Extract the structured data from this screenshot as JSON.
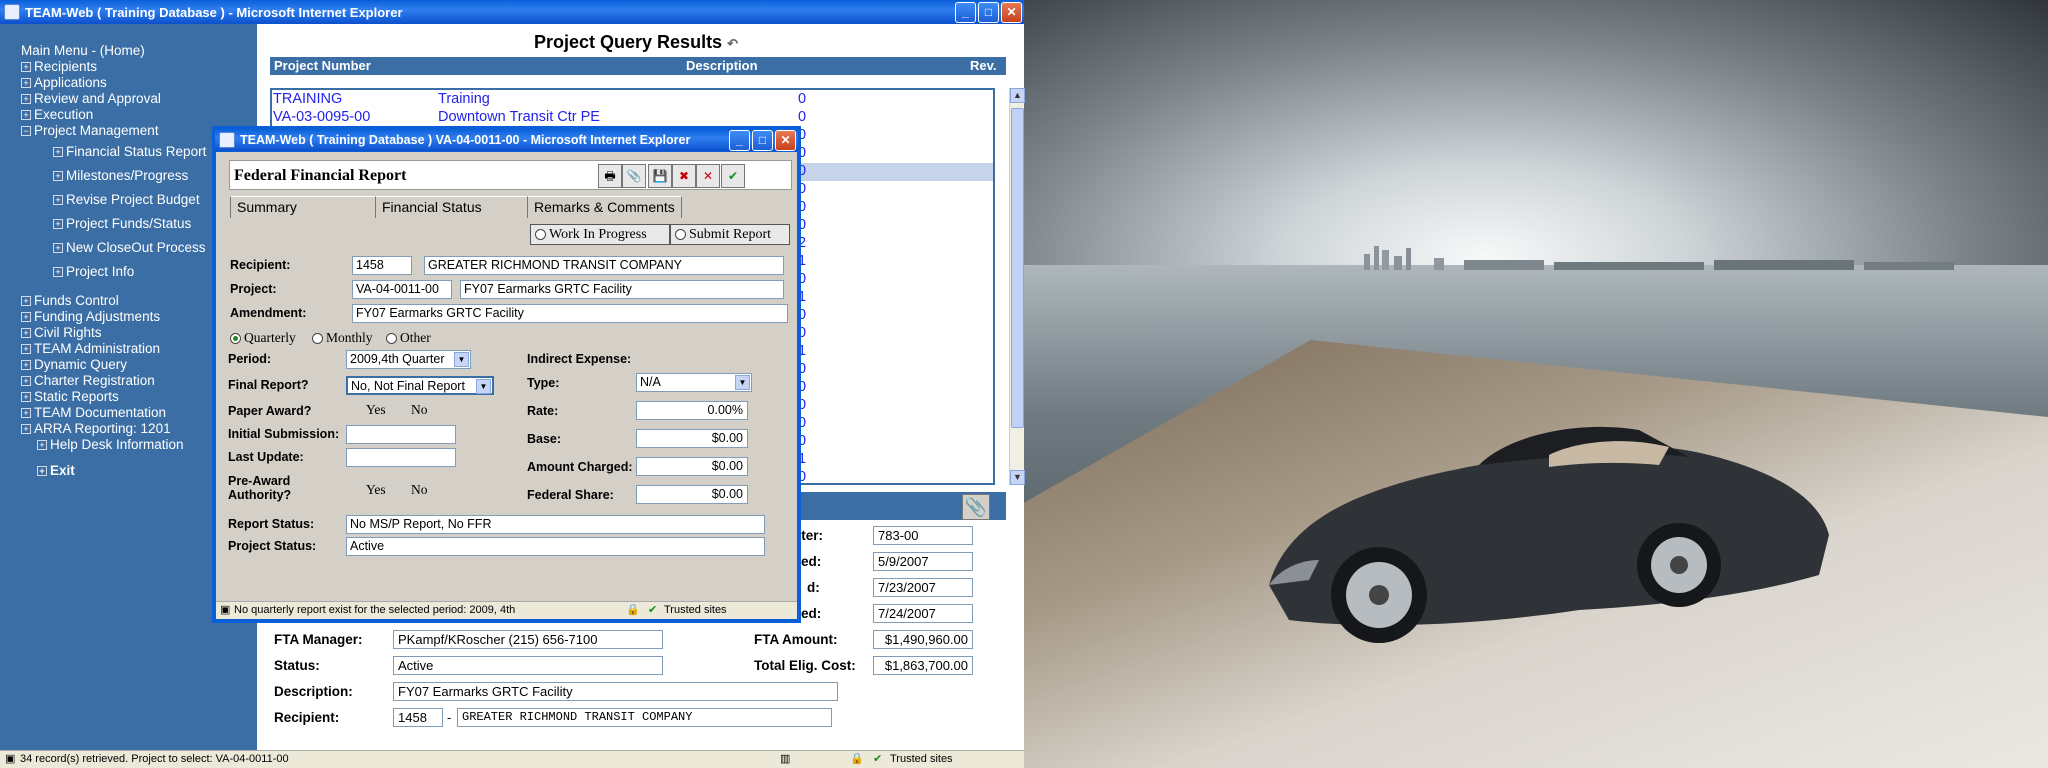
{
  "main_window": {
    "title": "TEAM-Web ( Training Database ) - Microsoft Internet Explorer",
    "minimize_label": "_",
    "maximize_label": "□",
    "close_label": "✕"
  },
  "sidebar": {
    "home": "Main Menu - (Home)",
    "items": [
      {
        "label": "Recipients"
      },
      {
        "label": "Applications"
      },
      {
        "label": "Review and Approval"
      },
      {
        "label": "Execution"
      },
      {
        "label": "Project Management",
        "expanded": true
      }
    ],
    "subitems": [
      {
        "label": "Financial Status Report"
      },
      {
        "label": "Milestones/Progress"
      },
      {
        "label": "Revise Project Budget"
      },
      {
        "label": "Project Funds/Status"
      },
      {
        "label": "New CloseOut Process"
      },
      {
        "label": "Project Info"
      }
    ],
    "items2": [
      {
        "label": "Funds Control"
      },
      {
        "label": "Funding Adjustments"
      },
      {
        "label": "Civil Rights"
      },
      {
        "label": "TEAM Administration"
      },
      {
        "label": "Dynamic Query"
      },
      {
        "label": "Charter Registration"
      },
      {
        "label": "Static Reports"
      },
      {
        "label": "TEAM Documentation"
      },
      {
        "label": "ARRA Reporting: 1201"
      }
    ],
    "help": "Help Desk Information",
    "exit": "Exit"
  },
  "results": {
    "title": "Project Query Results",
    "columns": {
      "number": "Project Number",
      "description": "Description",
      "rev": "Rev."
    },
    "rows": [
      {
        "number": "TRAINING",
        "description": "Training",
        "rev": "0"
      },
      {
        "number": "VA-03-0095-00",
        "description": "Downtown Transit Ctr PE",
        "rev": "0"
      },
      {
        "number": "",
        "description": "",
        "rev": "0"
      },
      {
        "number": "",
        "description": "",
        "rev": "0"
      },
      {
        "number": "",
        "description": "",
        "rev": "0",
        "selected": true
      },
      {
        "number": "",
        "description": "",
        "rev": "0"
      },
      {
        "number": "",
        "description": "",
        "rev": "0"
      },
      {
        "number": "",
        "description": "",
        "rev": "0"
      },
      {
        "number": "",
        "description": "",
        "rev": "2"
      },
      {
        "number": "",
        "description": "",
        "rev": "1"
      },
      {
        "number": "",
        "description": "",
        "rev": "0"
      },
      {
        "number": "",
        "description": "",
        "rev": "1"
      },
      {
        "number": "",
        "description": "",
        "rev": "0"
      },
      {
        "number": "",
        "description": "",
        "rev": "0"
      },
      {
        "number": "",
        "description": "",
        "rev": "1"
      },
      {
        "number": "",
        "description": "",
        "rev": "0"
      },
      {
        "number": "",
        "description": "",
        "rev": "0"
      },
      {
        "number": "",
        "description": "",
        "rev": "0"
      },
      {
        "number": "",
        "description": "",
        "rev": "0"
      },
      {
        "number": "",
        "description": "",
        "rev": "0"
      },
      {
        "number": "",
        "description": "",
        "rev": "1"
      },
      {
        "number": "",
        "description": "",
        "rev": "0"
      }
    ]
  },
  "details": {
    "cost_center_label": "nter:",
    "cost_center_value": "783-00",
    "date1_label": "ed:",
    "date1_value": "5/9/2007",
    "date2_label": "d:",
    "date2_value": "7/23/2007",
    "date3_label": "ed:",
    "date3_value": "7/24/2007",
    "fta_manager_label": "FTA Manager:",
    "fta_manager_value": "PKampf/KRoscher (215) 656-7100",
    "fta_amount_label": "FTA Amount:",
    "fta_amount_value": "$1,490,960.00",
    "status_label": "Status:",
    "status_value": "Active",
    "total_elig_label": "Total Elig. Cost:",
    "total_elig_value": "$1,863,700.00",
    "description_label": "Description:",
    "description_value": "FY07 Earmarks GRTC Facility",
    "recipient_label": "Recipient:",
    "recipient_id": "1458",
    "recipient_sep": "-",
    "recipient_name": "GREATER RICHMOND TRANSIT COMPANY"
  },
  "main_status": {
    "text": "34 record(s) retrieved. Project to select: VA-04-0011-00",
    "zone": "Trusted sites"
  },
  "popup": {
    "title": "TEAM-Web ( Training Database ) VA-04-0011-00 - Microsoft Internet Explorer",
    "header": "Federal Financial Report",
    "tools": {
      "print": "🖶",
      "attach": "📎",
      "save": "💾",
      "delete": "✖",
      "cancel": "✕",
      "ok": "✔"
    },
    "tabs": {
      "summary": "Summary",
      "financial_status": "Financial Status",
      "remarks": "Remarks & Comments"
    },
    "work_in_progress": "Work In Progress",
    "submit_report": "Submit Report",
    "recipient_label": "Recipient:",
    "recipient_id": "1458",
    "recipient_name": "GREATER RICHMOND TRANSIT COMPANY",
    "project_label": "Project:",
    "project_id": "VA-04-0011-00",
    "project_name": "FY07 Earmarks GRTC Facility",
    "amendment_label": "Amendment:",
    "amendment_value": "FY07 Earmarks GRTC Facility",
    "freq": {
      "quarterly": "Quarterly",
      "monthly": "Monthly",
      "other": "Other"
    },
    "period_label": "Period:",
    "period_value": "2009,4th Quarter",
    "final_report_label": "Final Report?",
    "final_report_value": "No, Not Final Report",
    "paper_award_label": "Paper Award?",
    "yes": "Yes",
    "no": "No",
    "initial_submission_label": "Initial Submission:",
    "last_update_label": "Last Update:",
    "pre_award_label": "Pre-Award\nAuthority?",
    "indirect_expense_label": "Indirect Expense:",
    "type_label": "Type:",
    "type_value": "N/A",
    "rate_label": "Rate:",
    "rate_value": "0.00%",
    "base_label": "Base:",
    "base_value": "$0.00",
    "amount_charged_label": "Amount Charged:",
    "amount_charged_value": "$0.00",
    "federal_share_label": "Federal Share:",
    "federal_share_value": "$0.00",
    "report_status_label": "Report Status:",
    "report_status_value": "No MS/P Report, No FFR",
    "project_status_label": "Project Status:",
    "project_status_value": "Active",
    "status_text": "No quarterly report exist for the selected period: 2009, 4th",
    "zone": "Trusted sites"
  }
}
